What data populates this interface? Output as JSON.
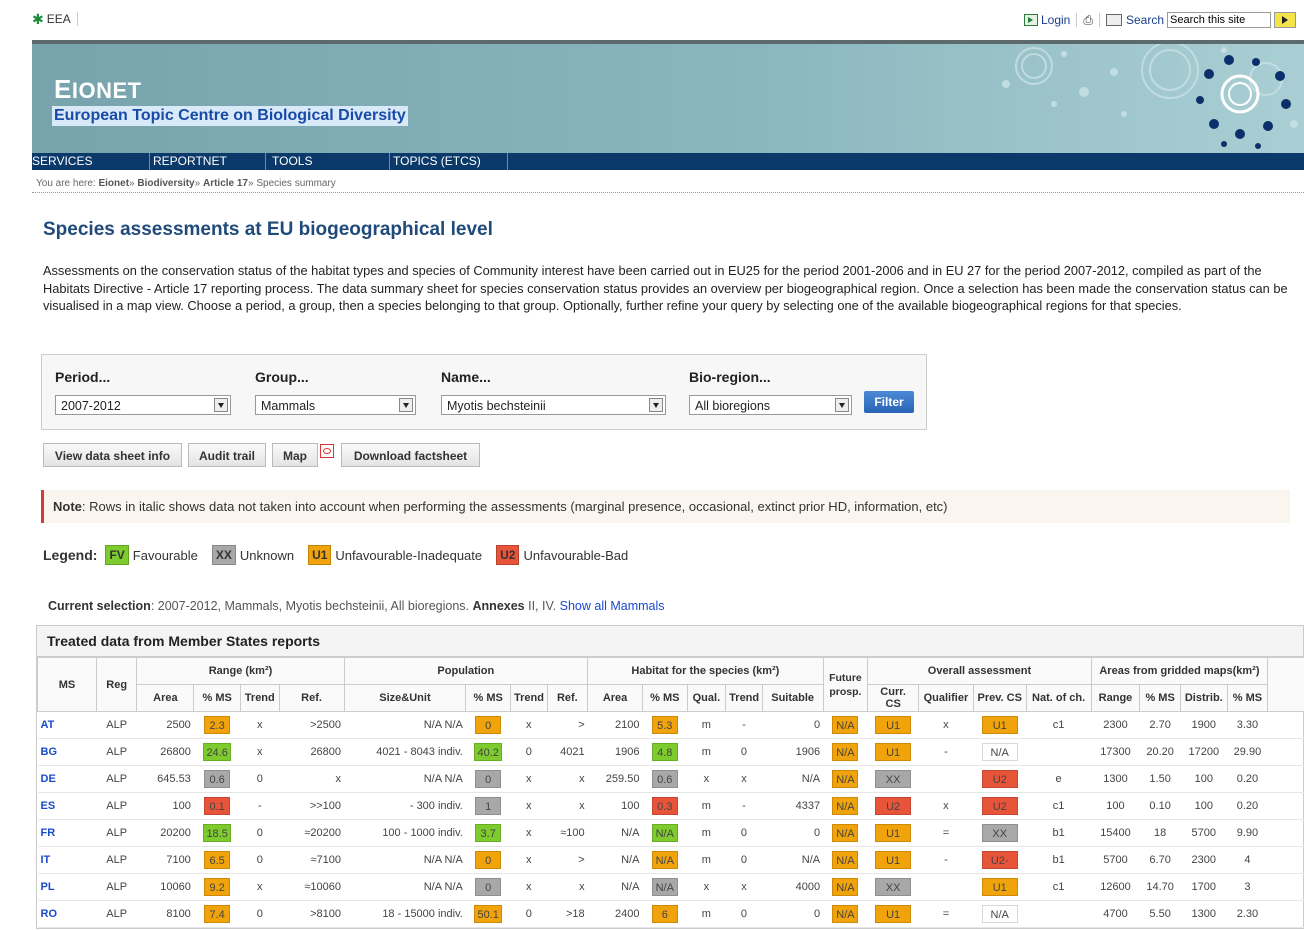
{
  "header": {
    "eea_label": "EEA",
    "login_label": "Login",
    "search_label": "Search",
    "search_placeholder": "Search this site"
  },
  "banner": {
    "title_first": "E",
    "title_rest": "IONET",
    "subtitle": "European Topic Centre on Biological Diversity"
  },
  "nav": [
    "SERVICES",
    "REPORTNET",
    "TOOLS",
    "TOPICS (ETCS)"
  ],
  "breadcrumb": {
    "prefix": "You are here:",
    "items": [
      "Eionet",
      "Biodiversity",
      "Article 17"
    ],
    "current": "Species summary",
    "separator": "»"
  },
  "page_title": "Species assessments at EU biogeographical level",
  "intro": "Assessments on the conservation status of the habitat types and species of Community interest have been carried out in EU25 for the period 2001-2006 and in EU 27 for the period 2007-2012, compiled as part of the Habitats Directive - Article 17 reporting process. The data summary sheet for species conservation status provides an overview per biogeographical region. Once a selection has been made the conservation status can be visualised in a map view. Choose a period, a group, then a species belonging to that group. Optionally, further refine your query by selecting one of the available biogeographical regions for that species.",
  "filters": {
    "period": {
      "label": "Period...",
      "value": "2007-2012"
    },
    "group": {
      "label": "Group...",
      "value": "Mammals"
    },
    "name": {
      "label": "Name...",
      "value": "Myotis bechsteinii"
    },
    "bioregion": {
      "label": "Bio-region...",
      "value": "All bioregions"
    },
    "filter_button": "Filter"
  },
  "actions": {
    "view_data_sheet": "View data sheet info",
    "audit_trail": "Audit trail",
    "map": "Map",
    "download_factsheet": "Download factsheet"
  },
  "note": {
    "label": "Note",
    "text": ": Rows in italic shows data not taken into account when performing the assessments (marginal presence, occasional, extinct prior HD, information, etc)"
  },
  "legend": {
    "label": "Legend:",
    "items": [
      {
        "code": "FV",
        "text": "Favourable",
        "color": "#7ecb2e"
      },
      {
        "code": "XX",
        "text": "Unknown",
        "color": "#a8a8a8"
      },
      {
        "code": "U1",
        "text": "Unfavourable-Inadequate",
        "color": "#f0a30a"
      },
      {
        "code": "U2",
        "text": "Unfavourable-Bad",
        "color": "#e8543a"
      }
    ]
  },
  "current_selection": {
    "label": "Current selection",
    "text": ": 2007-2012, Mammals, Myotis bechsteinii, All bioregions.",
    "annexes_label": "Annexes",
    "annexes_value": " II, IV.",
    "link": "Show all Mammals"
  },
  "table": {
    "caption": "Treated data from Member States reports",
    "group_headers": {
      "ms": "MS",
      "reg": "Reg",
      "range": "Range (km²)",
      "population": "Population",
      "habitat": "Habitat for the species (km²)",
      "future": "Future prosp.",
      "overall": "Overall assessment",
      "gridded": "Areas from gridded maps(km²)"
    },
    "sub_headers": [
      "Area",
      "% MS",
      "Trend",
      "Ref.",
      "Size&Unit",
      "% MS",
      "Trend",
      "Ref.",
      "Area",
      "% MS",
      "Qual.",
      "Trend",
      "Suitable",
      "Curr. CS",
      "Qualifier",
      "Prev. CS",
      "Nat. of ch.",
      "Range",
      "% MS",
      "Distrib.",
      "% MS"
    ],
    "rows": [
      {
        "ms": "AT",
        "reg": "ALP",
        "r_area": "2500",
        "r_ms": "2.3",
        "r_trend": "x",
        "r_ref": ">2500",
        "p_size": "N/A N/A",
        "p_ms": "0",
        "p_trend": "x",
        "p_ref": ">",
        "h_area": "2100",
        "h_ms": "5.3",
        "h_qual": "m",
        "h_trend": "-",
        "h_suit": "0",
        "fp": "N/A",
        "curr": "U1",
        "qual": "x",
        "prev": "U1",
        "nat": "c1",
        "g_range": "2300",
        "g_ms": "2.70",
        "g_dist": "1900",
        "g_ms2": "3.30",
        "c_rms": "U1",
        "c_pms": "U1",
        "c_hms": "U1",
        "c_fp": "U1",
        "c_curr": "U1",
        "c_prev": "U1"
      },
      {
        "ms": "BG",
        "reg": "ALP",
        "r_area": "26800",
        "r_ms": "24.6",
        "r_trend": "x",
        "r_ref": "26800",
        "p_size": "4021 - 8043 indiv.",
        "p_ms": "40.2",
        "p_trend": "0",
        "p_ref": "4021",
        "h_area": "1906",
        "h_ms": "4.8",
        "h_qual": "m",
        "h_trend": "0",
        "h_suit": "1906",
        "fp": "N/A",
        "curr": "U1",
        "qual": "-",
        "prev": "N/A",
        "nat": "",
        "g_range": "17300",
        "g_ms": "20.20",
        "g_dist": "17200",
        "g_ms2": "29.90",
        "c_rms": "FV",
        "c_pms": "FV",
        "c_hms": "FV",
        "c_fp": "U1",
        "c_curr": "U1",
        "c_prev": ""
      },
      {
        "ms": "DE",
        "reg": "ALP",
        "r_area": "645.53",
        "r_ms": "0.6",
        "r_trend": "0",
        "r_ref": "x",
        "p_size": "N/A N/A",
        "p_ms": "0",
        "p_trend": "x",
        "p_ref": "x",
        "h_area": "259.50",
        "h_ms": "0.6",
        "h_qual": "x",
        "h_trend": "x",
        "h_suit": "N/A",
        "fp": "N/A",
        "curr": "XX",
        "qual": "",
        "prev": "U2",
        "nat": "e",
        "g_range": "1300",
        "g_ms": "1.50",
        "g_dist": "100",
        "g_ms2": "0.20",
        "c_rms": "XX",
        "c_pms": "XX",
        "c_hms": "XX",
        "c_fp": "XX",
        "c_curr": "XX",
        "c_prev": "U2"
      },
      {
        "ms": "ES",
        "reg": "ALP",
        "r_area": "100",
        "r_ms": "0.1",
        "r_trend": "-",
        "r_ref": ">>100",
        "p_size": "- 300 indiv.",
        "p_ms": "1",
        "p_trend": "x",
        "p_ref": "x",
        "h_area": "100",
        "h_ms": "0.3",
        "h_qual": "m",
        "h_trend": "-",
        "h_suit": "4337",
        "fp": "N/A",
        "curr": "U2",
        "qual": "x",
        "prev": "U2",
        "nat": "c1",
        "g_range": "100",
        "g_ms": "0.10",
        "g_dist": "100",
        "g_ms2": "0.20",
        "c_rms": "U2",
        "c_pms": "XX",
        "c_hms": "U2",
        "c_fp": "U2",
        "c_curr": "U2",
        "c_prev": "U2"
      },
      {
        "ms": "FR",
        "reg": "ALP",
        "r_area": "20200",
        "r_ms": "18.5",
        "r_trend": "0",
        "r_ref": "≈20200",
        "p_size": "100 - 1000 indiv.",
        "p_ms": "3.7",
        "p_trend": "x",
        "p_ref": "≈100",
        "h_area": "N/A",
        "h_ms": "N/A",
        "h_qual": "m",
        "h_trend": "0",
        "h_suit": "0",
        "fp": "N/A",
        "curr": "U1",
        "qual": "=",
        "prev": "XX",
        "nat": "b1",
        "g_range": "15400",
        "g_ms": "18",
        "g_dist": "5700",
        "g_ms2": "9.90",
        "c_rms": "FV",
        "c_pms": "FV",
        "c_hms": "FV",
        "c_fp": "U1",
        "c_curr": "U1",
        "c_prev": "XX"
      },
      {
        "ms": "IT",
        "reg": "ALP",
        "r_area": "7100",
        "r_ms": "6.5",
        "r_trend": "0",
        "r_ref": "≈7100",
        "p_size": "N/A N/A",
        "p_ms": "0",
        "p_trend": "x",
        "p_ref": ">",
        "h_area": "N/A",
        "h_ms": "N/A",
        "h_qual": "m",
        "h_trend": "0",
        "h_suit": "N/A",
        "fp": "N/A",
        "curr": "U1",
        "qual": "-",
        "prev": "U2-",
        "nat": "b1",
        "g_range": "5700",
        "g_ms": "6.70",
        "g_dist": "2300",
        "g_ms2": "4",
        "c_rms": "U1",
        "c_pms": "U1",
        "c_hms": "U1",
        "c_fp": "U1",
        "c_curr": "U1",
        "c_prev": "U2"
      },
      {
        "ms": "PL",
        "reg": "ALP",
        "r_area": "10060",
        "r_ms": "9.2",
        "r_trend": "x",
        "r_ref": "≈10060",
        "p_size": "N/A N/A",
        "p_ms": "0",
        "p_trend": "x",
        "p_ref": "x",
        "h_area": "N/A",
        "h_ms": "N/A",
        "h_qual": "x",
        "h_trend": "x",
        "h_suit": "4000",
        "fp": "N/A",
        "curr": "XX",
        "qual": "",
        "prev": "U1",
        "nat": "c1",
        "g_range": "12600",
        "g_ms": "14.70",
        "g_dist": "1700",
        "g_ms2": "3",
        "c_rms": "U1",
        "c_pms": "XX",
        "c_hms": "XX",
        "c_fp": "XX",
        "c_curr": "XX",
        "c_prev": "U1"
      },
      {
        "ms": "RO",
        "reg": "ALP",
        "r_area": "8100",
        "r_ms": "7.4",
        "r_trend": "0",
        "r_ref": ">8100",
        "p_size": "18 - 15000 indiv.",
        "p_ms": "50.1",
        "p_trend": "0",
        "p_ref": ">18",
        "h_area": "2400",
        "h_ms": "6",
        "h_qual": "m",
        "h_trend": "0",
        "h_suit": "0",
        "fp": "N/A",
        "curr": "U1",
        "qual": "=",
        "prev": "N/A",
        "nat": "",
        "g_range": "4700",
        "g_ms": "5.50",
        "g_dist": "1300",
        "g_ms2": "2.30",
        "c_rms": "U1",
        "c_pms": "U1",
        "c_hms": "U1",
        "c_fp": "U1",
        "c_curr": "U1",
        "c_prev": ""
      }
    ]
  },
  "colors": {
    "FV": "#7ecb2e",
    "XX": "#a8a8a8",
    "U1": "#f0a30a",
    "U2": "#e8543a",
    "link": "#1a4acc",
    "banner": "#8ab5bd",
    "nav": "#0b3a6a"
  }
}
